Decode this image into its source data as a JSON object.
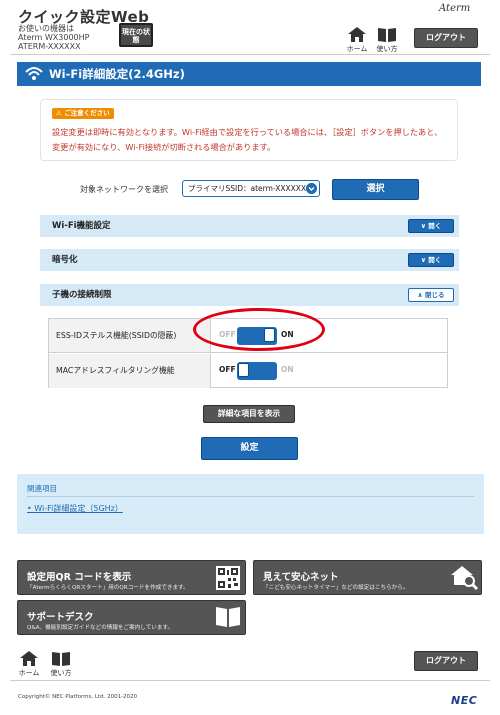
{
  "header": {
    "app_title": "クイック設定Web",
    "device_label": "お使いの機器は",
    "device_model": "Aterm WX3000HP",
    "device_id": "ATERM-XXXXXX",
    "status_button": "現在の状態",
    "brand": "Aterm",
    "home_label": "ホーム",
    "help_label": "使い方",
    "logout_label": "ログアウト"
  },
  "page": {
    "title": "Wi-Fi詳細設定(2.4GHz)"
  },
  "notice": {
    "badge": "ご注意ください",
    "text": "設定変更は即時に有効となります。Wi-Fi経由で設定を行っている場合には、［設定］ボタンを押したあと、変更が有効になり、Wi-Fi接続が切断される場合があります。"
  },
  "network_selector": {
    "label": "対象ネットワークを選択",
    "selected": "プライマリSSID：aterm-XXXXXX-g",
    "button": "選択"
  },
  "sections": [
    {
      "title": "Wi-Fi機能設定",
      "button": "開く"
    },
    {
      "title": "暗号化",
      "button": "開く"
    },
    {
      "title": "子機の接続制限",
      "button": "閉じる"
    }
  ],
  "settings": [
    {
      "label": "ESS-IDステルス機能(SSIDの隠蔽)",
      "off": "OFF",
      "on": "ON",
      "state": "ON"
    },
    {
      "label": "MACアドレスフィルタリング機能",
      "off": "OFF",
      "on": "ON",
      "state": "OFF"
    }
  ],
  "actions": {
    "detail_button": "詳細な項目を表示",
    "save_button": "設定"
  },
  "related": {
    "title": "関連項目",
    "link": "Wi-Fi詳細設定（5GHz）"
  },
  "cards": {
    "qr": {
      "title": "設定用QR コードを表示",
      "desc": "「AtermらくらくQRスタート」用のQRコードを作成できます。"
    },
    "safe": {
      "title": "見えて安心ネット",
      "desc": "「こども安心ネットタイマー」などの設定はこちらから。"
    },
    "support": {
      "title": "サポートデスク",
      "desc": "Q&A、機能別設定ガイドなどの情報をご案内しています。"
    }
  },
  "footer": {
    "home_label": "ホーム",
    "help_label": "使い方",
    "logout_label": "ログアウト",
    "copyright": "Copyright© NEC Platforms, Ltd. 2001-2020",
    "logo": "NEC"
  },
  "colors": {
    "accent": "#1f6bb5",
    "section_bg": "#d6e9f7",
    "alert_text": "#c0392b",
    "alert_badge": "#f08c00",
    "highlight_ring": "#e00012"
  }
}
